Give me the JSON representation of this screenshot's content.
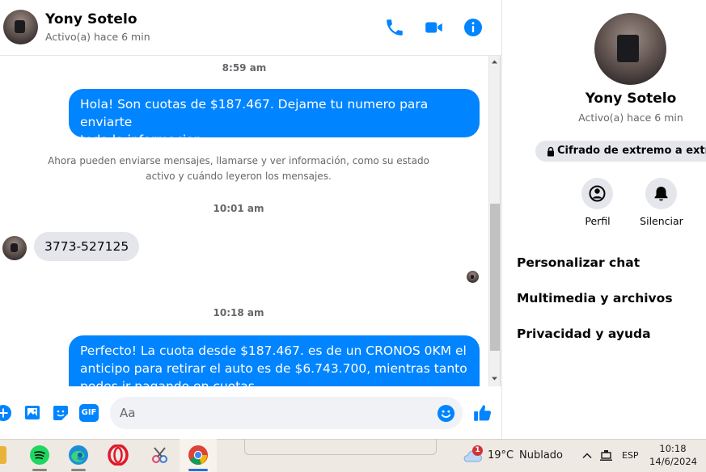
{
  "header": {
    "name": "Yony Sotelo",
    "status": "Activo(a) hace 6 min"
  },
  "messages": {
    "time1": "8:59 am",
    "out1_line1": "Hola! Son cuotas de $187.467. Dejame tu numero para enviarte",
    "out1_line2": "toda la informacion",
    "system_line1": "Ahora pueden enviarse mensajes, llamarse y ver información, como su estado",
    "system_line2": "activo y cuándo leyeron los mensajes.",
    "time2": "10:01 am",
    "in1": "3773-527125",
    "time3": "10:18 am",
    "out2_line1": "Perfecto! La cuota desde $187.467. es de un CRONOS 0KM el",
    "out2_line2": "anticipo para retirar el auto es de $6.743.700, mientras tanto",
    "out2_line3": "podes ir pagando en cuotas"
  },
  "composer": {
    "placeholder": "Aa",
    "gif_label": "GIF"
  },
  "panel": {
    "name": "Yony Sotelo",
    "status": "Activo(a) hace 6 min",
    "encryption": "Cifrado de extremo a extremo",
    "profile_label": "Perfil",
    "mute_label": "Silenciar",
    "items": [
      "Personalizar chat",
      "Multimedia y archivos",
      "Privacidad y ayuda"
    ]
  },
  "taskbar": {
    "notification_count": "1",
    "temperature": "19°C",
    "weather": "Nublado",
    "language": "ESP",
    "time": "10:18",
    "date": "14/6/2024"
  },
  "colors": {
    "accent": "#0084ff",
    "bubble_in": "#e4e6eb",
    "taskbar": "#efe9e3"
  }
}
